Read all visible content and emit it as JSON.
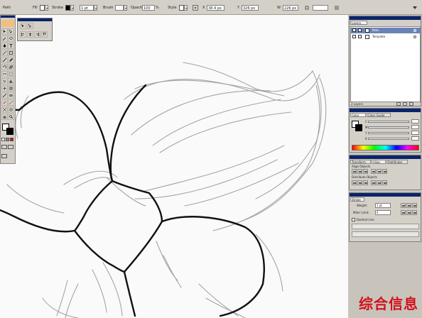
{
  "control_bar": {
    "path_label": "Path",
    "fill_label": "Fill",
    "stroke_label": "Stroke",
    "stroke_weight": "1 pt",
    "brush_label": "Brush",
    "opacity_label": "Opacity",
    "opacity_value": "100",
    "opacity_unit": "%",
    "style_label": "Style",
    "x_value": "38.4 px",
    "y_value": "326 px",
    "w_value": "226 px"
  },
  "layers_panel": {
    "title": "Layers",
    "layers": [
      {
        "name": "Main",
        "selected": true
      },
      {
        "name": "Template",
        "selected": false
      }
    ],
    "footer": "2 Layers"
  },
  "color_panel": {
    "tabs": [
      "Color",
      "Color Guide"
    ]
  },
  "align_panel": {
    "tabs": [
      "Transform",
      "Align",
      "Pathfinder"
    ],
    "section_objects": "Align Objects",
    "section_distribute": "Distribute Objects"
  },
  "stroke_panel": {
    "title": "Stroke",
    "weight_label": "Weight:",
    "weight_value": "1 pt",
    "miter_label": "Miter Limit:",
    "miter_value": "4",
    "dashed_label": "Dashed Line"
  },
  "watermark": "综合信息",
  "colors": {
    "ui_gray": "#d4d0c8",
    "panel_title": "#0a246a",
    "sketch_stroke": "#111111",
    "pencil_gray": "#a0a0a0",
    "watermark_red": "#d4101a"
  }
}
